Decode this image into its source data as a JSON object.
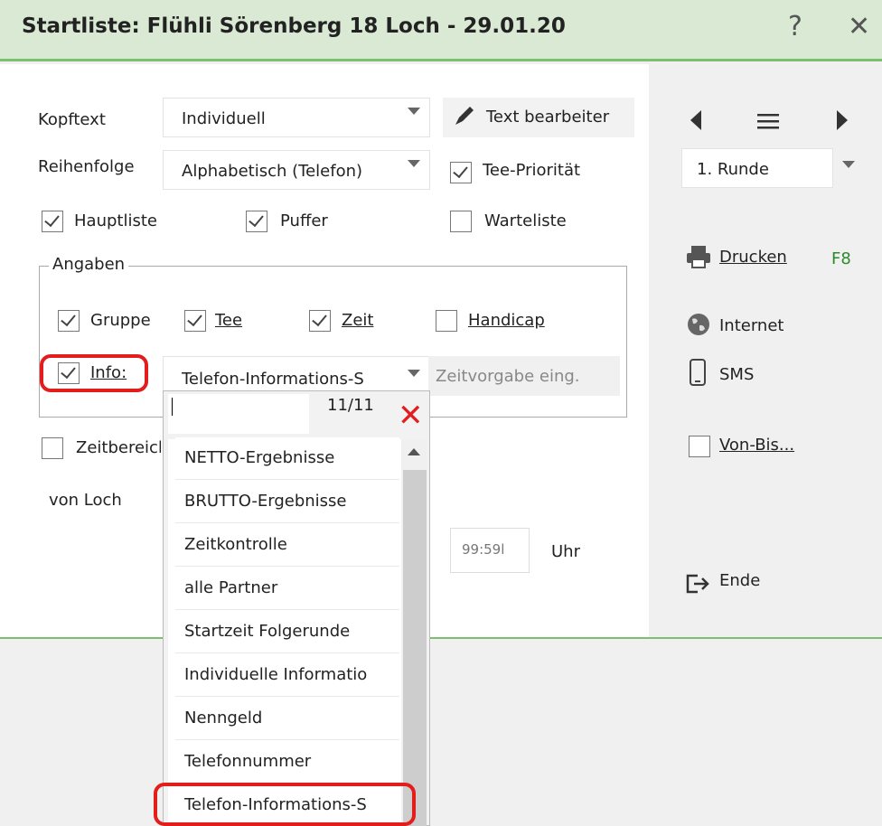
{
  "window": {
    "title": "Startliste: Flühli Sörenberg 18 Loch - 29.01.20",
    "help": "?",
    "close": "✕"
  },
  "form": {
    "kopftext_label": "Kopftext",
    "kopftext_value": "Individuell",
    "text_bearbeiten": "Text bearbeiter",
    "reihenfolge_label": "Reihenfolge",
    "reihenfolge_value": "Alphabetisch (Telefon)",
    "tee_prioritaet": "Tee-Priorität",
    "hauptliste": "Hauptliste",
    "puffer": "Puffer",
    "warteliste": "Warteliste",
    "angaben_legend": "Angaben",
    "gruppe": "Gruppe",
    "tee": "Tee",
    "zeit": "Zeit",
    "handicap": "Handicap",
    "info": "Info:",
    "info_value": "Telefon-Informations-S",
    "zeitvorgabe_placeholder": "Zeitvorgabe eing.",
    "zeitbereich": "Zeitbereich",
    "von_loch": "von Loch",
    "time_value": "99:59l",
    "uhr": "Uhr"
  },
  "dropdown": {
    "search_value": "",
    "counter": "11/11",
    "clear_icon": "✕",
    "items": [
      "NETTO-Ergebnisse",
      "BRUTTO-Ergebnisse",
      "Zeitkontrolle",
      "alle Partner",
      "Startzeit Folgerunde",
      "Individuelle Informatio",
      "Nenngeld",
      "Telefonnummer",
      "Telefon-Informations-S"
    ],
    "selected_index": 8
  },
  "sidebar": {
    "runde": "1. Runde",
    "drucken": "Drucken",
    "drucken_key": "F8",
    "internet": "Internet",
    "sms": "SMS",
    "von_bis": "Von-Bis...",
    "ende": "Ende"
  },
  "colors": {
    "accent_green": "#7cbf6e",
    "title_bg": "#d9e9d3",
    "highlight_red": "#e31c1c",
    "clear_red": "#e02020"
  }
}
